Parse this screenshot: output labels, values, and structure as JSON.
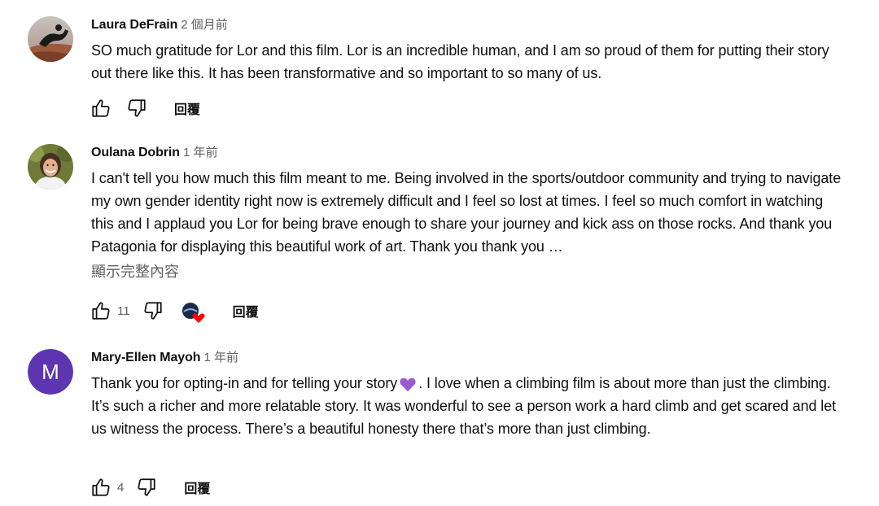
{
  "comments": [
    {
      "author": "Laura DeFrain",
      "time": "2 個月前",
      "text": "SO much gratitude for Lor and this film. Lor is an incredible human, and I am so proud of them for putting their story out there like this. It has been transformative and so important to so many of us.",
      "likes": "",
      "reply_label": "回覆",
      "avatar": "photo-person-on-rock"
    },
    {
      "author": "Oulana Dobrin",
      "time": "1 年前",
      "text": "I can't tell you how much this film meant to me. Being involved in the sports/outdoor community and trying to navigate my own gender identity right now is extremely difficult and I feel so lost at times. I feel so much comfort in watching this and I applaud you Lor for being brave enough to share your journey and kick ass on those rocks. And thank you Patagonia for displaying this beautiful work of art. Thank you thank you …",
      "show_more": "顯示完整內容",
      "likes": "11",
      "reply_label": "回覆",
      "creator_heart": true,
      "avatar": "photo-smiling-woman"
    },
    {
      "author": "Mary-Ellen Mayoh",
      "time": "1 年前",
      "text_before_emoji": "Thank you for opting-in and for telling your story",
      "emoji": "purple-heart",
      "text_after_emoji": ". I love when a climbing film is about more than just the climbing. It’s such a richer and more relatable story. It was wonderful to see a person work a hard climb and get scared and let us witness the process. There’s a beautiful honesty there that’s more than just climbing.",
      "likes": "4",
      "reply_label": "回覆",
      "avatar_letter": "M",
      "avatar_color": "#5e35b1"
    }
  ]
}
